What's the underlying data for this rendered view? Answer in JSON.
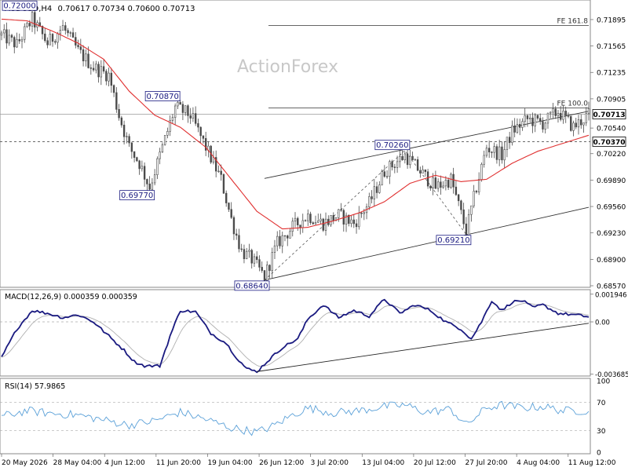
{
  "header": {
    "symbol": "AUDUSD,H4",
    "ohlc": "0.70617 0.70734 0.70600 0.70713"
  },
  "watermark": "ActionForex",
  "colors": {
    "candle": "#4a4a4a",
    "ma": "#e03030",
    "macd": "#1a1a80",
    "signal": "#b0b0b0",
    "rsi": "#5aa0d8",
    "label_border": "#1a1a80",
    "label_text": "#1a1a80",
    "grid": "#c8c8c8",
    "trendline": "#333333"
  },
  "chart_data": [
    {
      "type": "candlestick",
      "panel": "price",
      "ylim": [
        0.6857,
        0.7212
      ],
      "y_ticks": [
        "0.71895",
        "0.71565",
        "0.71235",
        "0.70905",
        "0.70540",
        "0.70220",
        "0.69890",
        "0.69560",
        "0.69230",
        "0.68900",
        "0.68570"
      ],
      "x_ticks": [
        "20 May 2026",
        "28 May 04:00",
        "4 Jun 12:00",
        "11 Jun 20:00",
        "19 Jun 04:00",
        "26 Jun 12:00",
        "3 Jul 20:00",
        "13 Jul 04:00",
        "20 Jul 12:00",
        "27 Jul 20:00",
        "4 Aug 04:00",
        "11 Aug 12:00"
      ],
      "current_price": "0.70713",
      "level_line": "0.70370",
      "fibonacci": [
        {
          "label": "FE 161.8",
          "value": 0.7182
        },
        {
          "label": "FE 100.0",
          "value": 0.7079
        }
      ],
      "annotations": [
        {
          "text": "0.72000",
          "bar": 12,
          "value": 0.72
        },
        {
          "text": "0.70870",
          "bar": 68,
          "value": 0.7087
        },
        {
          "text": "0.69770",
          "bar": 58,
          "value": 0.6977
        },
        {
          "text": "0.68640",
          "bar": 103,
          "value": 0.6864
        },
        {
          "text": "0.70260",
          "bar": 158,
          "value": 0.7026
        },
        {
          "text": "0.69210",
          "bar": 182,
          "value": 0.6921
        }
      ],
      "channel": {
        "lower": [
          [
            103,
            0.6864
          ],
          [
            230,
            0.6955
          ]
        ],
        "upper": [
          [
            103,
            0.6991
          ],
          [
            230,
            0.7075
          ]
        ]
      },
      "zigzag": [
        [
          103,
          0.6864
        ],
        [
          158,
          0.7026
        ],
        [
          182,
          0.6921
        ]
      ],
      "anchors": [
        [
          0,
          0.717
        ],
        [
          6,
          0.7158
        ],
        [
          12,
          0.719
        ],
        [
          18,
          0.716
        ],
        [
          24,
          0.718
        ],
        [
          30,
          0.715
        ],
        [
          36,
          0.713
        ],
        [
          42,
          0.712
        ],
        [
          46,
          0.707
        ],
        [
          50,
          0.703
        ],
        [
          54,
          0.701
        ],
        [
          58,
          0.698
        ],
        [
          62,
          0.702
        ],
        [
          66,
          0.706
        ],
        [
          68,
          0.708
        ],
        [
          74,
          0.707
        ],
        [
          80,
          0.703
        ],
        [
          86,
          0.699
        ],
        [
          90,
          0.694
        ],
        [
          94,
          0.69
        ],
        [
          98,
          0.689
        ],
        [
          103,
          0.6868
        ],
        [
          108,
          0.691
        ],
        [
          114,
          0.693
        ],
        [
          120,
          0.6945
        ],
        [
          126,
          0.6935
        ],
        [
          132,
          0.6945
        ],
        [
          138,
          0.6935
        ],
        [
          144,
          0.696
        ],
        [
          150,
          0.7
        ],
        [
          154,
          0.701
        ],
        [
          158,
          0.702
        ],
        [
          164,
          0.7
        ],
        [
          170,
          0.698
        ],
        [
          176,
          0.699
        ],
        [
          182,
          0.6925
        ],
        [
          186,
          0.698
        ],
        [
          190,
          0.703
        ],
        [
          196,
          0.702
        ],
        [
          200,
          0.705
        ],
        [
          206,
          0.7065
        ],
        [
          212,
          0.706
        ],
        [
          218,
          0.7075
        ],
        [
          224,
          0.7055
        ],
        [
          230,
          0.7071
        ]
      ],
      "ma_anchors": [
        [
          0,
          0.719
        ],
        [
          10,
          0.7188
        ],
        [
          20,
          0.7175
        ],
        [
          30,
          0.716
        ],
        [
          40,
          0.714
        ],
        [
          50,
          0.71
        ],
        [
          60,
          0.707
        ],
        [
          70,
          0.7055
        ],
        [
          80,
          0.703
        ],
        [
          90,
          0.699
        ],
        [
          100,
          0.695
        ],
        [
          110,
          0.6928
        ],
        [
          120,
          0.693
        ],
        [
          130,
          0.6938
        ],
        [
          140,
          0.6948
        ],
        [
          150,
          0.6962
        ],
        [
          160,
          0.6985
        ],
        [
          170,
          0.6995
        ],
        [
          180,
          0.6987
        ],
        [
          190,
          0.699
        ],
        [
          200,
          0.701
        ],
        [
          210,
          0.7025
        ],
        [
          220,
          0.7035
        ],
        [
          230,
          0.7045
        ]
      ],
      "bars": 231
    },
    {
      "type": "line",
      "panel": "macd",
      "label": "MACD(12,26,9) 0.000359 0.000359",
      "ylim": [
        -0.0037,
        0.0021
      ],
      "y_ticks": [
        "0.001946",
        "0.00",
        "-0.003685"
      ],
      "zero_label": "0.00",
      "macd_anchors": [
        [
          0,
          -0.0025
        ],
        [
          6,
          -0.0005
        ],
        [
          12,
          0.0008
        ],
        [
          18,
          0.0006
        ],
        [
          24,
          0.0003
        ],
        [
          30,
          0.0005
        ],
        [
          36,
          0.0
        ],
        [
          42,
          -0.001
        ],
        [
          48,
          -0.002
        ],
        [
          52,
          -0.0028
        ],
        [
          56,
          -0.0031
        ],
        [
          62,
          -0.0031
        ],
        [
          66,
          -0.001
        ],
        [
          70,
          0.0008
        ],
        [
          76,
          0.0007
        ],
        [
          82,
          -0.0008
        ],
        [
          88,
          -0.0015
        ],
        [
          92,
          -0.0025
        ],
        [
          96,
          -0.0033
        ],
        [
          100,
          -0.0035
        ],
        [
          104,
          -0.0028
        ],
        [
          110,
          -0.0018
        ],
        [
          116,
          -0.0012
        ],
        [
          120,
          0.0002
        ],
        [
          126,
          0.0012
        ],
        [
          132,
          0.0003
        ],
        [
          138,
          0.0008
        ],
        [
          144,
          0.0004
        ],
        [
          150,
          0.0016
        ],
        [
          156,
          0.0006
        ],
        [
          162,
          0.0012
        ],
        [
          168,
          0.0008
        ],
        [
          174,
          0.0
        ],
        [
          180,
          -0.0005
        ],
        [
          184,
          -0.0012
        ],
        [
          188,
          0.0
        ],
        [
          192,
          0.0015
        ],
        [
          196,
          0.0008
        ],
        [
          200,
          0.0014
        ],
        [
          204,
          0.0015
        ],
        [
          208,
          0.001
        ],
        [
          212,
          0.0012
        ],
        [
          218,
          0.0006
        ],
        [
          224,
          0.0005
        ],
        [
          230,
          0.00036
        ]
      ],
      "trendline": [
        [
          100,
          -0.0035
        ],
        [
          230,
          -0.0001
        ]
      ]
    },
    {
      "type": "line",
      "panel": "rsi",
      "label": "RSI(14) 57.9865",
      "ylim": [
        0,
        100
      ],
      "y_ticks": [
        "100",
        "70",
        "30",
        "0"
      ],
      "rsi_anchors": [
        [
          0,
          50
        ],
        [
          10,
          58
        ],
        [
          20,
          54
        ],
        [
          30,
          52
        ],
        [
          40,
          45
        ],
        [
          50,
          38
        ],
        [
          60,
          44
        ],
        [
          70,
          56
        ],
        [
          80,
          46
        ],
        [
          90,
          34
        ],
        [
          100,
          28
        ],
        [
          106,
          36
        ],
        [
          114,
          52
        ],
        [
          120,
          62
        ],
        [
          130,
          55
        ],
        [
          140,
          58
        ],
        [
          150,
          64
        ],
        [
          158,
          66
        ],
        [
          166,
          56
        ],
        [
          176,
          60
        ],
        [
          182,
          38
        ],
        [
          190,
          62
        ],
        [
          196,
          66
        ],
        [
          204,
          62
        ],
        [
          212,
          64
        ],
        [
          220,
          58
        ],
        [
          230,
          58
        ]
      ]
    }
  ]
}
